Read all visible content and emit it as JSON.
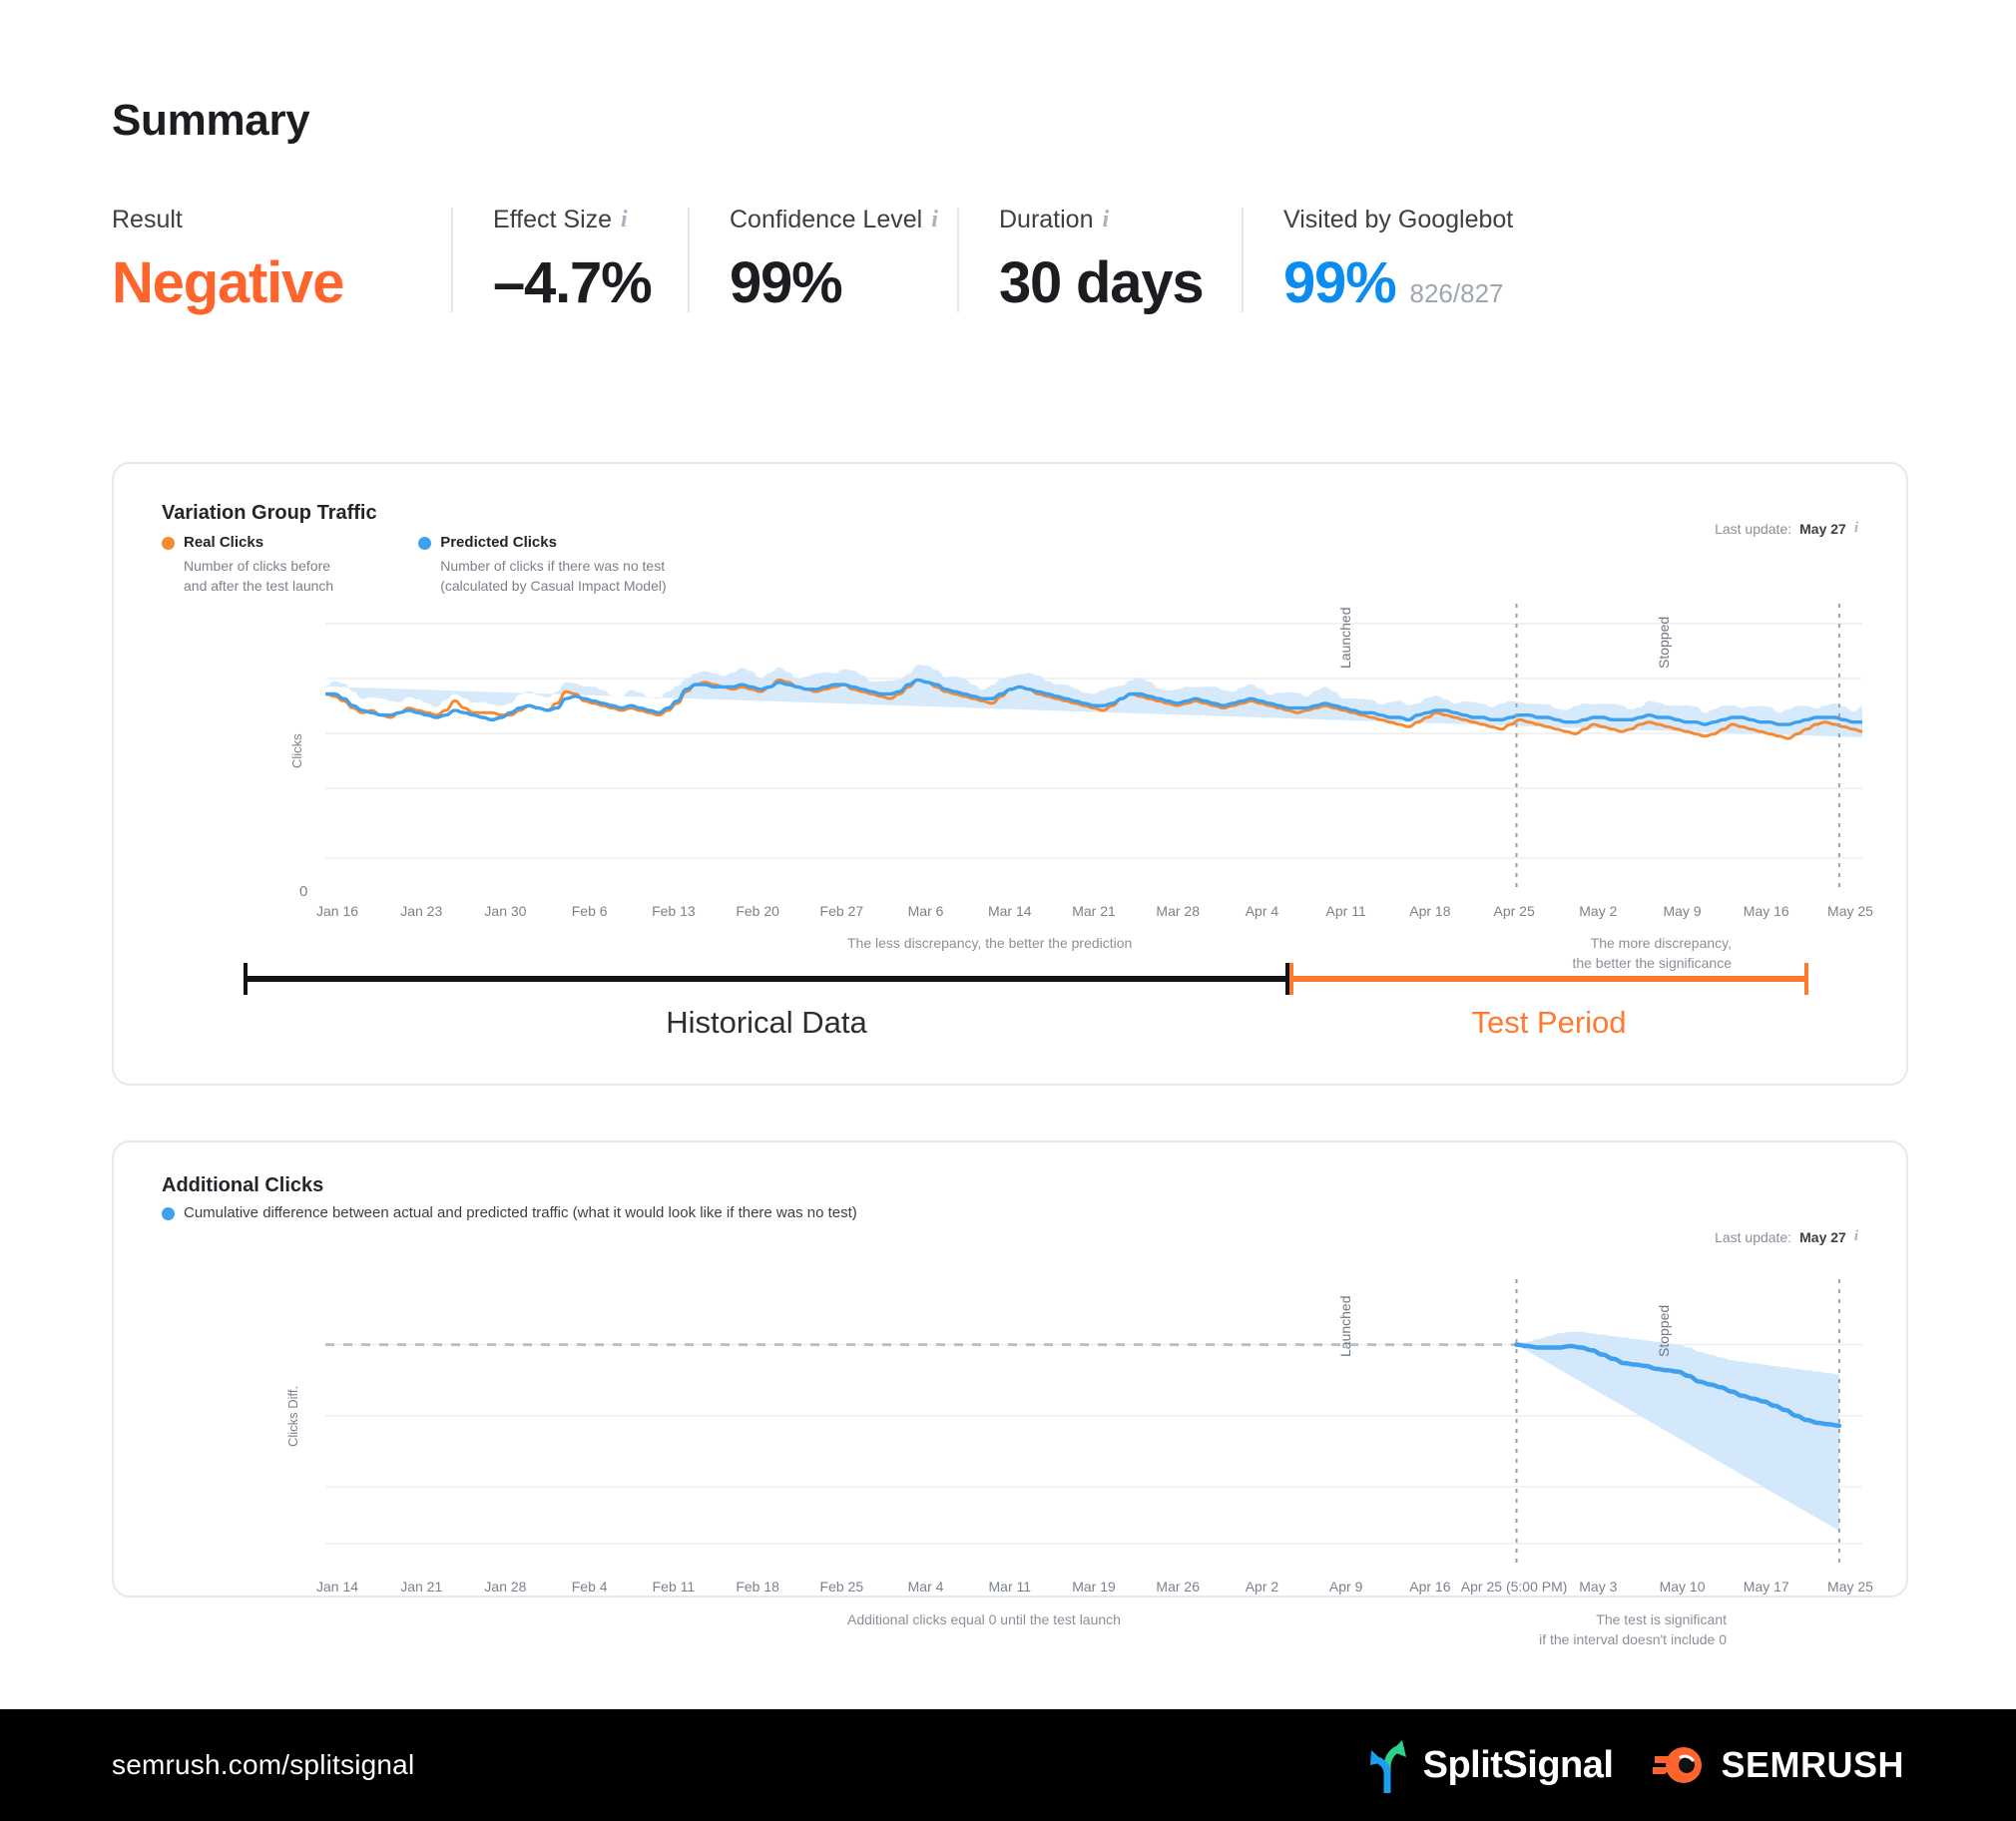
{
  "page": {
    "title": "Summary"
  },
  "stats": [
    {
      "label": "Result",
      "info": false,
      "value": "Negative",
      "value_color": "#ff642d",
      "sub": ""
    },
    {
      "label": "Effect Size",
      "info": true,
      "value": "–4.7%",
      "value_color": "#1b1d21",
      "sub": ""
    },
    {
      "label": "Confidence Level",
      "info": true,
      "value": "99%",
      "value_color": "#1b1d21",
      "sub": ""
    },
    {
      "label": "Duration",
      "info": true,
      "value": "30 days",
      "value_color": "#1b1d21",
      "sub": ""
    },
    {
      "label": "Visited by Googlebot",
      "info": false,
      "value": "99%",
      "value_color": "#0b8cf0",
      "sub": "826/827"
    }
  ],
  "traffic_card": {
    "title": "Variation Group Traffic",
    "last_update_prefix": "Last update:",
    "last_update_value": "May 27",
    "legend": [
      {
        "name": "Real Clicks",
        "desc": "Number of clicks before\nand after the test launch",
        "color": "#f68a33"
      },
      {
        "name": "Predicted Clicks",
        "desc": "Number of clicks if there was no test\n(calculated by Casual Impact Model)",
        "color": "#3fa0ed"
      }
    ],
    "ylabel": "Clicks",
    "zero_label": "0",
    "caption_left": "The less discrepancy, the better the prediction",
    "caption_right": "The more discrepancy,\nthe better the significance",
    "marker_launched": "Launched",
    "marker_stopped": "Stopped",
    "bracket_historical": "Historical Data",
    "bracket_test": "Test Period"
  },
  "additional_card": {
    "title": "Additional Clicks",
    "legend_desc": "Cumulative difference between actual and predicted traffic (what it would look like if there was no test)",
    "legend_color": "#3fa0ed",
    "last_update_prefix": "Last update:",
    "last_update_value": "May 27",
    "ylabel": "Clicks Diff.",
    "caption_left": "Additional clicks equal 0 until the test launch",
    "caption_right": "The test is significant\nif the interval doesn't include 0",
    "marker_launched": "Launched",
    "marker_stopped": "Stopped"
  },
  "footer": {
    "url": "semrush.com/splitsignal",
    "splitsignal_name": "SplitSignal",
    "semrush_name": "SEMRUSH"
  },
  "chart_data": [
    {
      "type": "line",
      "title": "Variation Group Traffic",
      "xlabel": "",
      "ylabel": "Clicks",
      "grid": true,
      "legend_position": "top-left",
      "ylim": [
        0,
        100
      ],
      "yticks": [
        0
      ],
      "xticks": [
        "Jan 16",
        "Jan 23",
        "Jan 30",
        "Feb 6",
        "Feb 13",
        "Feb 20",
        "Feb 27",
        "Mar 6",
        "Mar 14",
        "Mar 21",
        "Mar 28",
        "Apr 4",
        "Apr 11",
        "Apr 18",
        "Apr 25",
        "May 2",
        "May 9",
        "May 16",
        "May 25"
      ],
      "annotations": [
        {
          "label": "Launched",
          "x_fraction": 0.775
        },
        {
          "label": "Stopped",
          "x_fraction": 0.985
        }
      ],
      "series": [
        {
          "name": "Real Clicks",
          "color": "#f68a33",
          "values": [
            70,
            69,
            67,
            64,
            62,
            63,
            61,
            60,
            62,
            64,
            63,
            62,
            61,
            63,
            67,
            64,
            62,
            62,
            62,
            61,
            61,
            63,
            65,
            64,
            63,
            66,
            71,
            70,
            67,
            66,
            65,
            64,
            63,
            64,
            63,
            62,
            61,
            63,
            66,
            71,
            74,
            75,
            74,
            73,
            72,
            73,
            72,
            71,
            73,
            76,
            75,
            73,
            72,
            71,
            72,
            73,
            74,
            72,
            71,
            70,
            69,
            68,
            70,
            73,
            76,
            75,
            73,
            71,
            70,
            69,
            68,
            67,
            66,
            69,
            72,
            73,
            72,
            70,
            69,
            68,
            67,
            66,
            65,
            64,
            63,
            65,
            68,
            70,
            69,
            68,
            67,
            66,
            65,
            66,
            67,
            66,
            65,
            64,
            65,
            66,
            67,
            66,
            65,
            64,
            63,
            62,
            63,
            64,
            65,
            64,
            63,
            62,
            61,
            60,
            59,
            58,
            57,
            56,
            58,
            60,
            62,
            61,
            60,
            59,
            58,
            57,
            56,
            55,
            57,
            59,
            58,
            57,
            56,
            55,
            54,
            53,
            55,
            57,
            56,
            55,
            54,
            55,
            57,
            58,
            57,
            56,
            55,
            54,
            53,
            52,
            53,
            55,
            57,
            56,
            55,
            54,
            53,
            52,
            51,
            53,
            55,
            57,
            58,
            57,
            56,
            55,
            54
          ]
        },
        {
          "name": "Predicted Clicks",
          "color": "#3fa0ed",
          "values": [
            70,
            70,
            68,
            65,
            63,
            62,
            61,
            61,
            62,
            63,
            62,
            61,
            60,
            61,
            63,
            62,
            61,
            60,
            59,
            60,
            62,
            64,
            65,
            64,
            63,
            64,
            68,
            69,
            68,
            67,
            66,
            65,
            64,
            65,
            64,
            63,
            62,
            64,
            67,
            72,
            74,
            74,
            73,
            73,
            73,
            74,
            73,
            72,
            73,
            75,
            74,
            73,
            72,
            72,
            73,
            74,
            74,
            73,
            72,
            71,
            70,
            70,
            71,
            74,
            76,
            75,
            74,
            72,
            71,
            70,
            69,
            68,
            68,
            70,
            72,
            73,
            72,
            71,
            70,
            69,
            68,
            67,
            66,
            65,
            65,
            66,
            68,
            70,
            70,
            69,
            68,
            67,
            66,
            67,
            68,
            67,
            66,
            65,
            66,
            67,
            68,
            67,
            66,
            65,
            64,
            64,
            64,
            65,
            66,
            65,
            64,
            63,
            62,
            62,
            61,
            60,
            60,
            59,
            61,
            62,
            63,
            63,
            62,
            61,
            60,
            60,
            59,
            59,
            60,
            61,
            61,
            60,
            60,
            59,
            58,
            58,
            59,
            60,
            60,
            59,
            59,
            59,
            60,
            61,
            60,
            60,
            59,
            58,
            58,
            57,
            58,
            59,
            60,
            60,
            59,
            58,
            58,
            57,
            57,
            58,
            59,
            60,
            60,
            60,
            59,
            58,
            58
          ],
          "confidence_band": true,
          "band_color": "#cfe6fb"
        }
      ],
      "caption_left": "The less discrepancy, the better the prediction",
      "caption_right": "The more discrepancy, the better the significance",
      "period_brackets": [
        {
          "label": "Historical Data",
          "color": "#111315"
        },
        {
          "label": "Test Period",
          "color": "#ff7a2f"
        }
      ]
    },
    {
      "type": "area",
      "title": "Additional Clicks",
      "xlabel": "",
      "ylabel": "Clicks Diff.",
      "grid": true,
      "legend_position": "top-left",
      "xticks": [
        "Jan 14",
        "Jan 21",
        "Jan 28",
        "Feb 4",
        "Feb 11",
        "Feb 18",
        "Feb 25",
        "Mar 4",
        "Mar 11",
        "Mar 19",
        "Mar 26",
        "Apr 2",
        "Apr 9",
        "Apr 16",
        "Apr 25 (5:00 PM)",
        "May 3",
        "May 10",
        "May 17",
        "May 25"
      ],
      "annotations": [
        {
          "label": "Launched",
          "x_fraction": 0.775
        },
        {
          "label": "Stopped",
          "x_fraction": 0.985
        }
      ],
      "zero_reference_line": true,
      "series": [
        {
          "name": "Cumulative difference",
          "color": "#3fa0ed",
          "band_color": "#cfe6fb",
          "values_pre_launch": 0,
          "values_post_launch": [
            0,
            -1,
            -2,
            -2,
            -2,
            -1,
            -2,
            -4,
            -7,
            -10,
            -13,
            -14,
            -15,
            -17,
            -18,
            -19,
            -22,
            -26,
            -28,
            -30,
            -33,
            -36,
            -38,
            -40,
            -43,
            -46,
            -50,
            -53,
            -55,
            -56,
            -57
          ],
          "band_lower": [
            0,
            -3,
            -6,
            -9,
            -12,
            -15,
            -19,
            -24,
            -29,
            -34,
            -39,
            -44,
            -49,
            -55,
            -60,
            -66,
            -72,
            -78,
            -84,
            -89,
            -94,
            -99,
            -104,
            -109,
            -113,
            -117,
            -121,
            -124,
            -127,
            -129,
            -131
          ],
          "band_upper": [
            0,
            2,
            4,
            6,
            8,
            9,
            9,
            8,
            7,
            6,
            5,
            4,
            3,
            2,
            1,
            0,
            -2,
            -5,
            -7,
            -9,
            -11,
            -12,
            -13,
            -14,
            -15,
            -16,
            -17,
            -18,
            -19,
            -20,
            -21
          ]
        }
      ],
      "caption_left": "Additional clicks equal 0 until the test launch",
      "caption_right": "The test is significant if the interval doesn't include 0"
    }
  ]
}
